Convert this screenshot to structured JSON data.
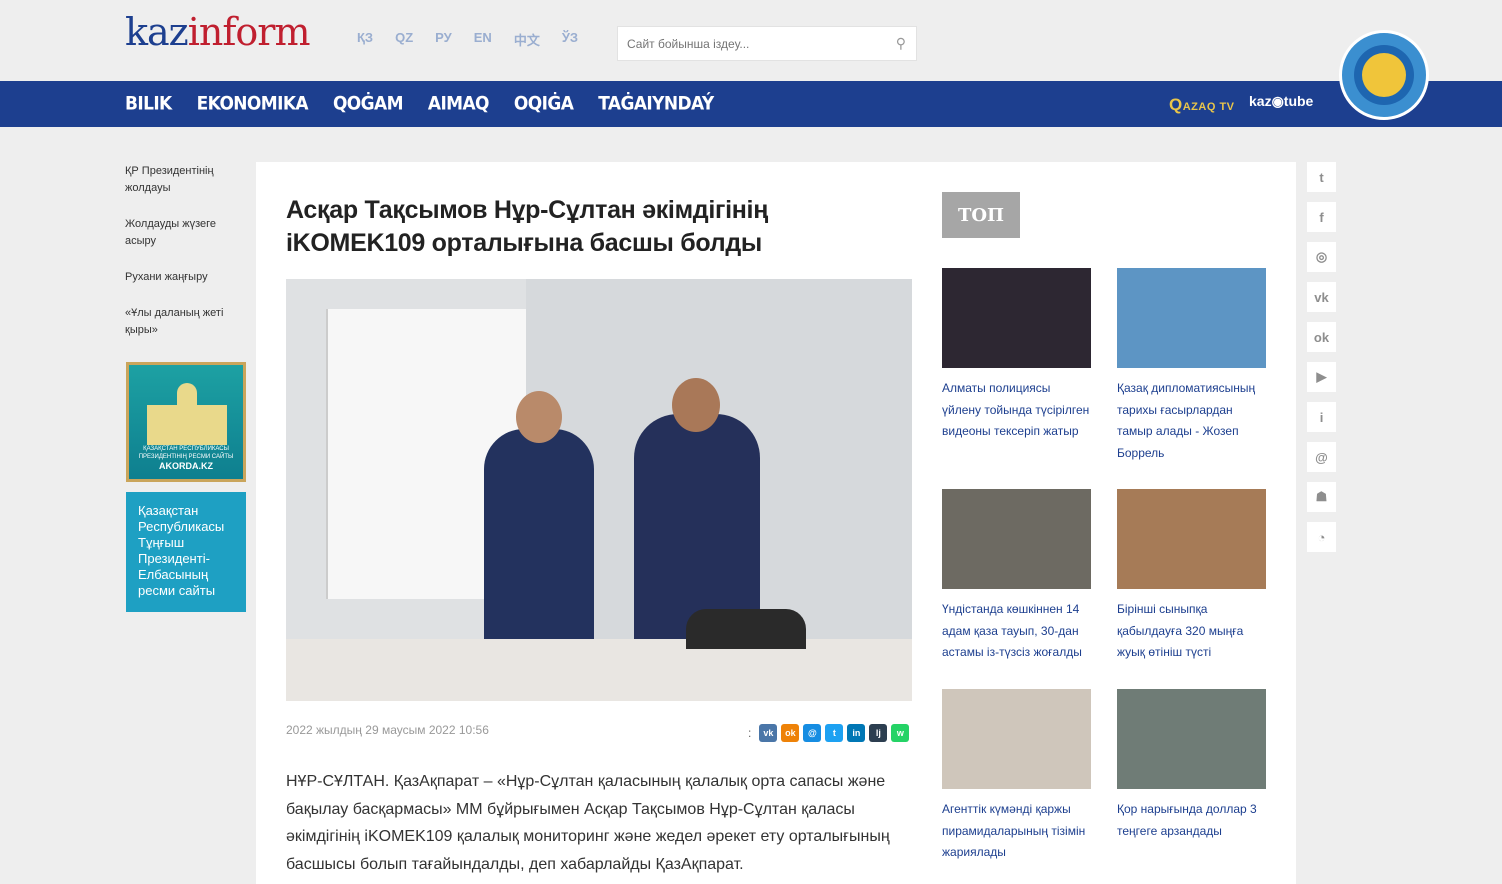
{
  "logo": {
    "part1": "kaz",
    "part2": "inform"
  },
  "languages": [
    "ҚЗ",
    "QZ",
    "РУ",
    "EN",
    "中文",
    "ЎЗ"
  ],
  "search": {
    "placeholder": "Сайт бойынша іздеу..."
  },
  "nav": [
    "BILIK",
    "EKONOMIKA",
    "QOĠAM",
    "AIMAQ",
    "OQIĠA",
    "TAĠAIYNDAÝ"
  ],
  "media": {
    "qazaq_big": "Q",
    "qazaq_rest": "AZAQ TV",
    "kaztube": "kaz◉tube"
  },
  "sidebar": {
    "links": [
      "ҚР Президентінің жолдауы",
      "Жолдауды жүзеге асыру",
      "Рухани жаңғыру",
      "«Ұлы даланың жеті қыры»"
    ],
    "akorda_caption": "ҚАЗАҚСТАН РЕСПУБЛИКАСЫ ПРЕЗИДЕНТІНІҢ РЕСМИ САЙТЫ",
    "akorda_site": "AKORDA.KZ",
    "elbasy_text": "Қазақстан Республикасы Тұңғыш Президенті-Елбасының ресми сайты"
  },
  "article": {
    "title": "Асқар Тақсымов Нұр-Сұлтан әкімдігінің iKOMEK109 орталығына басшы болды",
    "date": "2022 жылдың 29 маусым 2022 10:56",
    "share_colon": ":",
    "body": "НҰР-СҰЛТАН. ҚазАқпарат – «Нұр-Сұлтан қаласының қалалық орта сапасы және бақылау басқармасы» ММ бұйрығымен Асқар Тақсымов Нұр-Сұлтан қаласы әкімдігінің iKOMEK109 қалалық мониторинг және жедел әрекет ету орталығының басшысы болып тағайындалды, деп хабарлайды ҚазАқпарат."
  },
  "share_icons": [
    {
      "name": "vk-share-icon",
      "glyph": "vk",
      "color": "#4a76a8"
    },
    {
      "name": "ok-share-icon",
      "glyph": "ok",
      "color": "#ee8208"
    },
    {
      "name": "mailru-share-icon",
      "glyph": "@",
      "color": "#168de2"
    },
    {
      "name": "twitter-share-icon",
      "glyph": "t",
      "color": "#1da1f2"
    },
    {
      "name": "linkedin-share-icon",
      "glyph": "in",
      "color": "#0077b5"
    },
    {
      "name": "livejournal-share-icon",
      "glyph": "lj",
      "color": "#2c3e50"
    },
    {
      "name": "whatsapp-share-icon",
      "glyph": "w",
      "color": "#25d366"
    }
  ],
  "top": {
    "label": "ТОП",
    "items": [
      {
        "caption": "Алматы полициясы үйлену тойында түсірілген видеоны тексеріп жатыр",
        "color": "#2d2732"
      },
      {
        "caption": "Қазақ дипломатиясының тарихы ғасырлардан тамыр алады - Жозеп Боррель",
        "color": "#5d95c4"
      },
      {
        "caption": "Үндістанда көшкіннен 14 адам қаза тауып, 30-дан астамы із-түзсіз жоғалды",
        "color": "#6d6a62"
      },
      {
        "caption": "Бірінші сыныпқа қабылдауға 320 мыңға жуық өтініш түсті",
        "color": "#a67b57"
      },
      {
        "caption": "Агенттік күмәнді қаржы пирамидаларының тізімін жариялады",
        "color": "#cfc6bb"
      },
      {
        "caption": "Қор нарығында доллар 3 теңгеге арзандады",
        "color": "#6f7c76"
      }
    ]
  },
  "social": [
    {
      "name": "twitter-icon",
      "glyph": "t"
    },
    {
      "name": "facebook-icon",
      "glyph": "f"
    },
    {
      "name": "instagram-icon",
      "glyph": "◎"
    },
    {
      "name": "vk-icon",
      "glyph": "vk"
    },
    {
      "name": "odnoklassniki-icon",
      "glyph": "ok"
    },
    {
      "name": "youtube-icon",
      "glyph": "▶"
    },
    {
      "name": "info-icon",
      "glyph": "i"
    },
    {
      "name": "email-icon",
      "glyph": "@"
    },
    {
      "name": "android-icon",
      "glyph": "☗"
    },
    {
      "name": "rss-icon",
      "glyph": "◔"
    }
  ]
}
